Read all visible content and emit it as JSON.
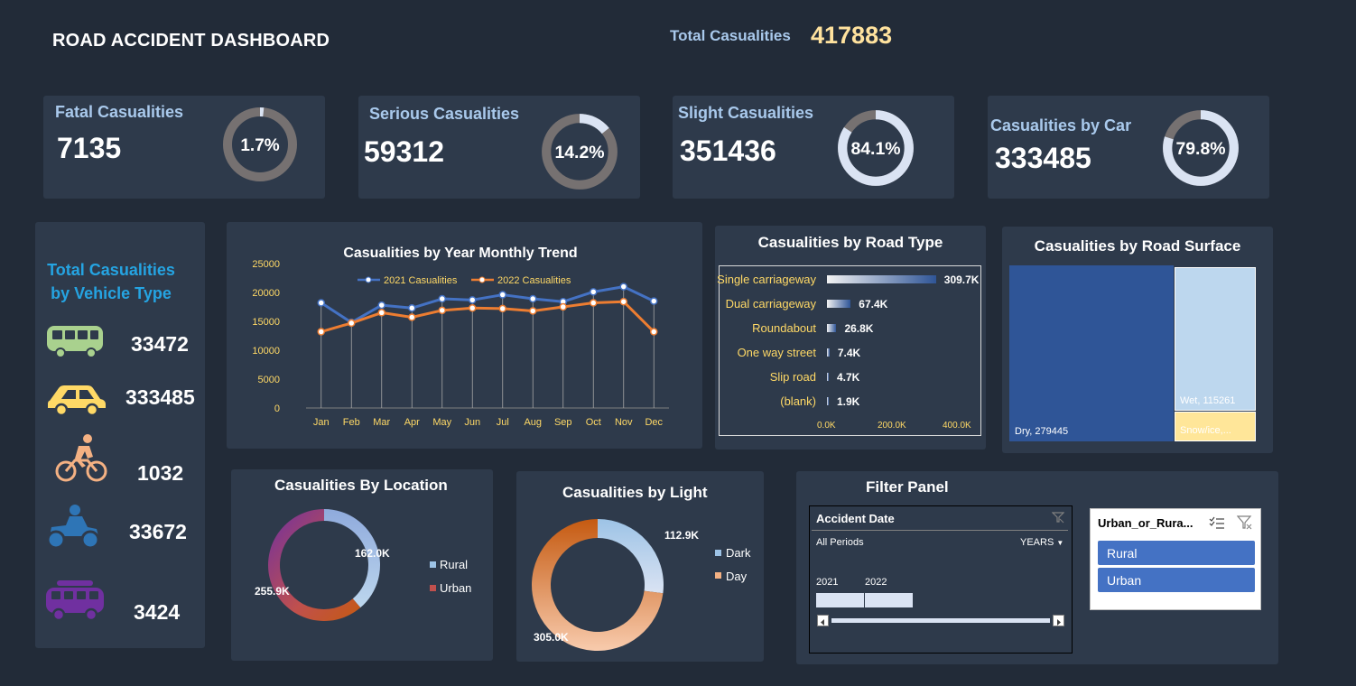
{
  "header": {
    "title": "ROAD ACCIDENT DASHBOARD",
    "total_label": "Total Casualities",
    "total_value": "417883"
  },
  "kpis": [
    {
      "label": "Fatal Casualities",
      "value": "7135",
      "pct_text": "1.7%",
      "pct": 1.7
    },
    {
      "label": "Serious Casualities",
      "value": "59312",
      "pct_text": "14.2%",
      "pct": 14.2
    },
    {
      "label": "Slight Casualities",
      "value": "351436",
      "pct_text": "84.1%",
      "pct": 84.1
    },
    {
      "label": "Casualities by Car",
      "value": "333485",
      "pct_text": "79.8%",
      "pct": 79.8
    }
  ],
  "vehicles": {
    "title_line1": "Total Casualities",
    "title_line2": "by Vehicle Type",
    "items": [
      {
        "icon": "bus-icon",
        "value": "33472",
        "color": "#a9d18e"
      },
      {
        "icon": "car-icon",
        "value": "333485",
        "color": "#ffd966"
      },
      {
        "icon": "bicycle-icon",
        "value": "1032",
        "color": "#f4b183"
      },
      {
        "icon": "motorcycle-icon",
        "value": "33672",
        "color": "#2e75b6"
      },
      {
        "icon": "van-icon",
        "value": "3424",
        "color": "#7030a0"
      }
    ]
  },
  "colors": {
    "background": "#222b38",
    "panel": "#2e3a4b",
    "accent_blue": "#4472c4",
    "accent_orange": "#ed7d31",
    "light_blue": "#bdd7ee",
    "yellow_text": "#ffd966"
  },
  "chart_data": [
    {
      "type": "line",
      "title": "Casualities by Year Monthly Trend",
      "x": [
        "Jan",
        "Feb",
        "Mar",
        "Apr",
        "May",
        "Jun",
        "Jul",
        "Aug",
        "Sep",
        "Oct",
        "Nov",
        "Dec"
      ],
      "yticks": [
        "0",
        "5000",
        "10000",
        "15000",
        "20000",
        "25000"
      ],
      "ylim": [
        0,
        25000
      ],
      "legend_position": "top",
      "series": [
        {
          "name": "2021 Casualities",
          "color": "#4472c4",
          "values": [
            18200,
            14800,
            17800,
            17300,
            18900,
            18700,
            19600,
            18900,
            18400,
            20100,
            21000,
            18500
          ]
        },
        {
          "name": "2022 Casualities",
          "color": "#ed7d31",
          "values": [
            13200,
            14700,
            16500,
            15700,
            16900,
            17300,
            17200,
            16800,
            17500,
            18200,
            18400,
            13200
          ]
        }
      ]
    },
    {
      "type": "bar",
      "orientation": "horizontal",
      "title": "Casualities by Road Type",
      "categories": [
        "Single carriageway",
        "Dual carriageway",
        "Roundabout",
        "One way street",
        "Slip road",
        "(blank)"
      ],
      "values": [
        309700,
        67400,
        26800,
        7400,
        4700,
        1900
      ],
      "labels": [
        "309.7K",
        "67.4K",
        "26.8K",
        "7.4K",
        "4.7K",
        "1.9K"
      ],
      "xticks": [
        "0.0K",
        "200.0K",
        "400.0K"
      ],
      "xlim": [
        0,
        400000
      ]
    },
    {
      "type": "treemap",
      "title": "Casualities by Road Surface",
      "categories": [
        "Dry",
        "Wet",
        "Snow/ice,..."
      ],
      "values": [
        279445,
        115261,
        23177
      ],
      "labels": [
        "Dry, 279445",
        "Wet, 115261",
        "Snow/ice,..."
      ],
      "colors": [
        "#2f5597",
        "#bdd7ee",
        "#ffe699"
      ]
    },
    {
      "type": "pie",
      "title": "Casualities By Location",
      "categories": [
        "Rural",
        "Urban"
      ],
      "values": [
        162000,
        255900
      ],
      "labels": [
        "162.0K",
        "255.9K"
      ],
      "legend_position": "right"
    },
    {
      "type": "pie",
      "title": "Casualities by Light",
      "categories": [
        "Dark",
        "Day"
      ],
      "values": [
        112900,
        305000
      ],
      "labels": [
        "112.9K",
        "305.0K"
      ],
      "legend_position": "right"
    }
  ],
  "filter_panel": {
    "title": "Filter Panel",
    "timeline": {
      "title": "Accident Date",
      "period": "All Periods",
      "unit": "YEARS",
      "years": [
        "2021",
        "2022"
      ]
    },
    "slicer": {
      "title": "Urban_or_Rura...",
      "items": [
        "Rural",
        "Urban"
      ]
    }
  }
}
